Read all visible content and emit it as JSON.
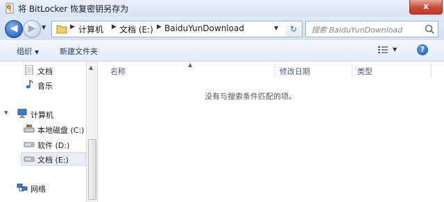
{
  "window": {
    "title": "将 BitLocker 恢复密钥另存为",
    "close_label": "x",
    "icons": {
      "app": "key-file-icon"
    }
  },
  "navigation": {
    "back_label": "◀",
    "forward_label": "▶",
    "breadcrumbs": [
      "计算机",
      "文档 (E:)",
      "BaiduYunDownload"
    ],
    "search_placeholder": "搜索 BaiduYunDownload"
  },
  "toolbar": {
    "organize_label": "组织",
    "new_folder_label": "新建文件夹"
  },
  "nav_pane": {
    "items": [
      {
        "label": "文档",
        "icon": "document-icon"
      },
      {
        "label": "音乐",
        "icon": "music-icon"
      },
      {
        "label": "计算机",
        "icon": "computer-icon"
      },
      {
        "label": "本地磁盘 (C:)",
        "icon": "local-disk-icon"
      },
      {
        "label": "软件 (D:)",
        "icon": "drive-icon"
      },
      {
        "label": "文档 (E:)",
        "icon": "drive-icon",
        "selected": true
      },
      {
        "label": "网络",
        "icon": "network-icon"
      }
    ]
  },
  "file_list": {
    "columns": [
      "名称",
      "修改日期",
      "类型"
    ],
    "empty_message": "没有与搜索条件匹配的项。"
  }
}
